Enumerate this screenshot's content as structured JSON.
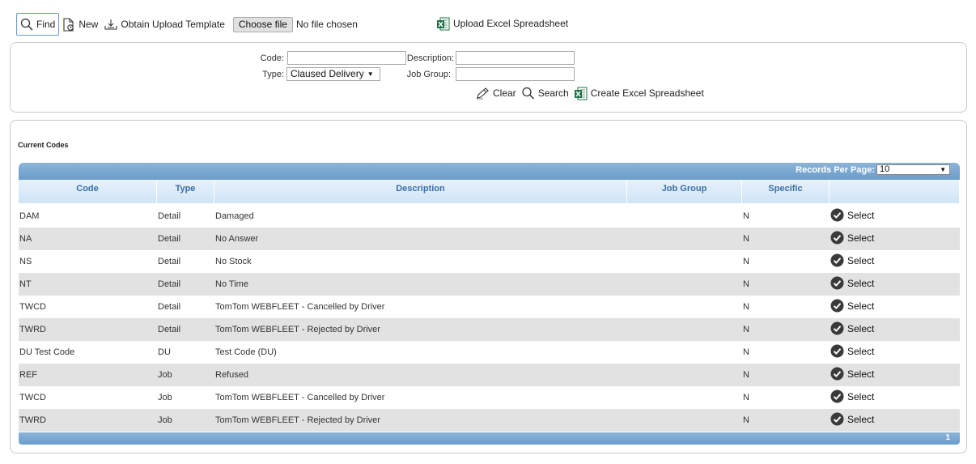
{
  "toolbar": {
    "find_label": "Find",
    "new_label": "New",
    "template_label": "Obtain Upload Template",
    "choose_file_label": "Choose file",
    "file_status": "No file chosen",
    "upload_label": "Upload Excel Spreadsheet"
  },
  "search": {
    "code_label": "Code:",
    "description_label": "Description:",
    "type_label": "Type:",
    "type_value": "Claused Delivery",
    "job_group_label": "Job Group:",
    "clear_label": "Clear",
    "search_label": "Search",
    "create_label": "Create Excel Spreadsheet"
  },
  "codes": {
    "title": "Current Codes",
    "records_per_page_label": "Records Per Page:",
    "records_per_page_value": "10",
    "columns": [
      "Code",
      "Type",
      "Description",
      "Job Group",
      "Specific",
      ""
    ],
    "select_label": "Select",
    "page": "1",
    "rows": [
      {
        "code": "DAM",
        "type": "Detail",
        "description": "Damaged",
        "job_group": "",
        "specific": "N"
      },
      {
        "code": "NA",
        "type": "Detail",
        "description": "No Answer",
        "job_group": "",
        "specific": "N"
      },
      {
        "code": "NS",
        "type": "Detail",
        "description": "No Stock",
        "job_group": "",
        "specific": "N"
      },
      {
        "code": "NT",
        "type": "Detail",
        "description": "No Time",
        "job_group": "",
        "specific": "N"
      },
      {
        "code": "TWCD",
        "type": "Detail",
        "description": "TomTom WEBFLEET - Cancelled by Driver",
        "job_group": "",
        "specific": "N"
      },
      {
        "code": "TWRD",
        "type": "Detail",
        "description": "TomTom WEBFLEET - Rejected by Driver",
        "job_group": "",
        "specific": "N"
      },
      {
        "code": "DU Test Code",
        "type": "DU",
        "description": "Test Code (DU)",
        "job_group": "",
        "specific": "N"
      },
      {
        "code": "REF",
        "type": "Job",
        "description": "Refused",
        "job_group": "",
        "specific": "N"
      },
      {
        "code": "TWCD",
        "type": "Job",
        "description": "TomTom WEBFLEET - Cancelled by Driver",
        "job_group": "",
        "specific": "N"
      },
      {
        "code": "TWRD",
        "type": "Job",
        "description": "TomTom WEBFLEET - Rejected by Driver",
        "job_group": "",
        "specific": "N"
      }
    ]
  },
  "icons": {
    "find": "magnifier-icon",
    "new": "new-document-icon",
    "template": "download-tray-icon",
    "excel": "excel-icon",
    "clear": "pencil-icon",
    "select": "check-circle-icon"
  },
  "colors": {
    "grid_header_bar": "#6a9dcc",
    "column_header_text": "#3a6ea5",
    "row_alt": "#e2e2e2",
    "excel_green": "#1e7145"
  }
}
